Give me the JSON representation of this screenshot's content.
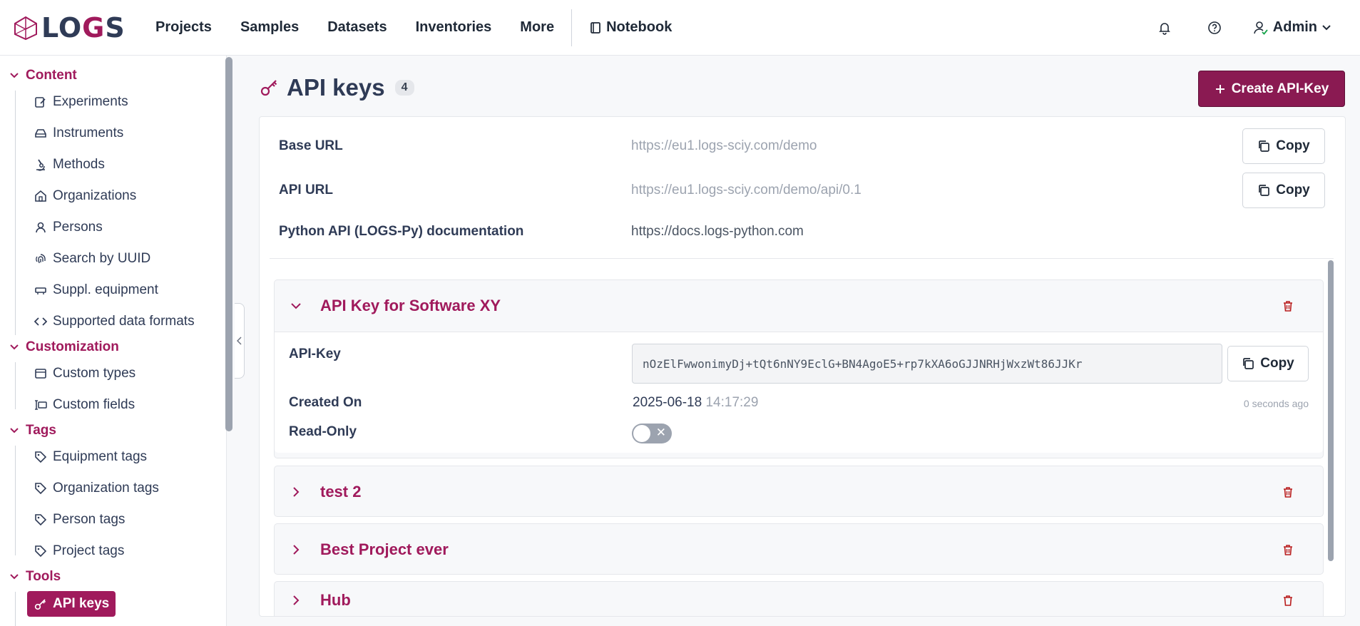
{
  "brand": {
    "logo_text_a": "LO",
    "logo_text_g": "G",
    "logo_text_b": "S"
  },
  "nav": {
    "items": [
      "Projects",
      "Samples",
      "Datasets",
      "Inventories",
      "More"
    ],
    "notebook": "Notebook",
    "user": "Admin"
  },
  "sidebar": {
    "sections": [
      {
        "title": "Content",
        "items": [
          "Experiments",
          "Instruments",
          "Methods",
          "Organizations",
          "Persons",
          "Search by UUID",
          "Suppl. equipment",
          "Supported data formats"
        ]
      },
      {
        "title": "Customization",
        "items": [
          "Custom types",
          "Custom fields"
        ]
      },
      {
        "title": "Tags",
        "items": [
          "Equipment tags",
          "Organization tags",
          "Person tags",
          "Project tags"
        ]
      },
      {
        "title": "Tools",
        "items": [
          "API keys"
        ]
      }
    ]
  },
  "page": {
    "title": "API keys",
    "count": "4",
    "create_button": "Create API-Key"
  },
  "info": {
    "base_url_label": "Base URL",
    "base_url_value": "https://eu1.logs-sciy.com/demo",
    "api_url_label": "API URL",
    "api_url_value": "https://eu1.logs-sciy.com/demo/api/0.1",
    "docs_label": "Python API (LOGS-Py) documentation",
    "docs_value": "https://docs.logs-python.com",
    "copy_label": "Copy"
  },
  "keys": [
    {
      "title": "API Key for Software XY",
      "expanded": true,
      "api_key_label": "API-Key",
      "api_key_value": "nOzElFwwonimyDj+tQt6nNY9EclG+BN4AgoE5+rp7kXA6oGJJNRHjWxzWt86JJKr",
      "created_label": "Created On",
      "created_date": "2025-06-18",
      "created_time": "14:17:29",
      "created_ago": "0 seconds ago",
      "readonly_label": "Read-Only",
      "readonly": false
    },
    {
      "title": "test 2",
      "expanded": false
    },
    {
      "title": "Best Project ever",
      "expanded": false
    },
    {
      "title": "Hub",
      "expanded": false
    }
  ],
  "colors": {
    "accent": "#a01a5c",
    "primary_button": "#8a1a52",
    "text": "#2f3b56"
  }
}
